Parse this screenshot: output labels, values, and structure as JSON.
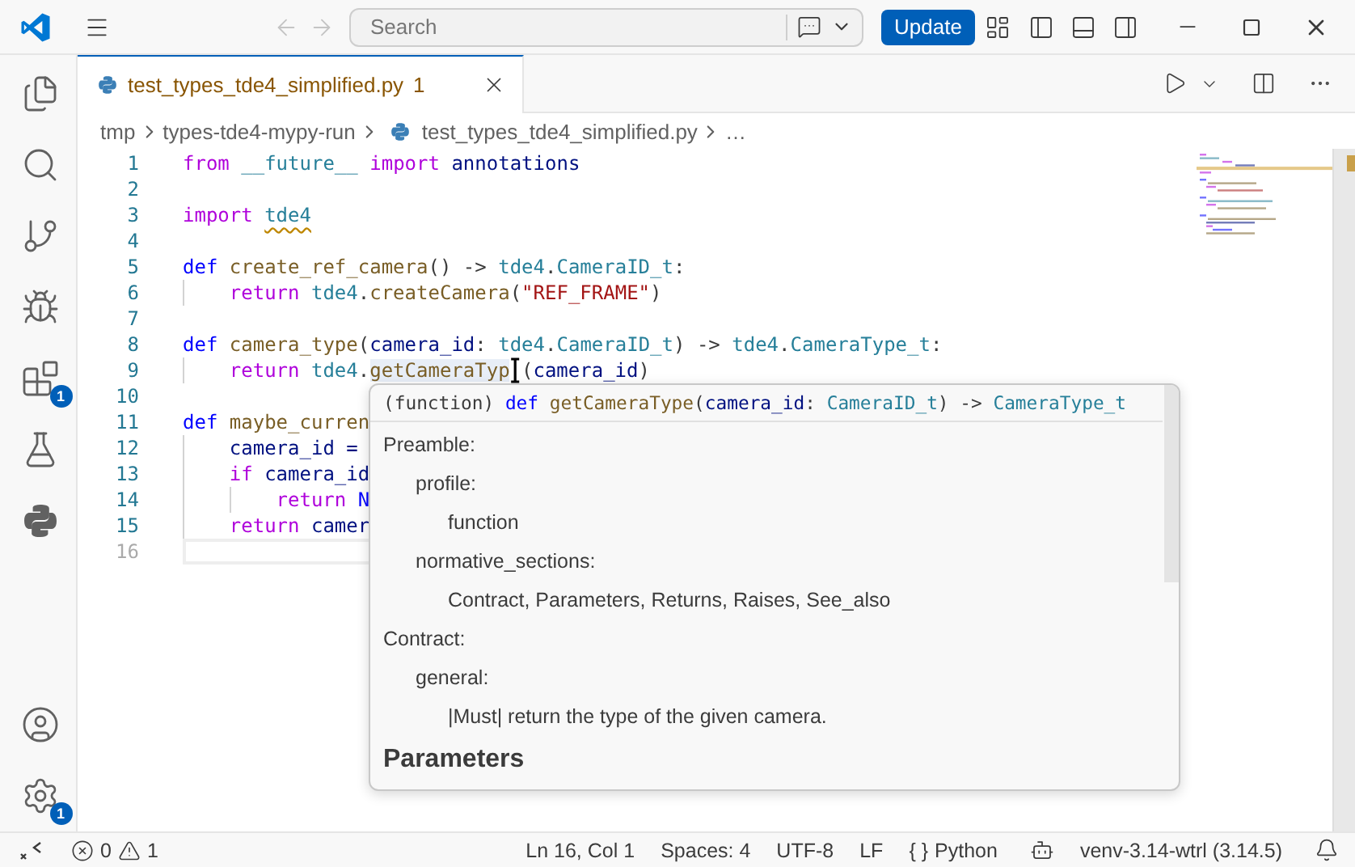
{
  "title_bar": {
    "nav": [
      {
        "kind": "back",
        "disabled": true
      },
      {
        "kind": "forward",
        "disabled": true
      }
    ],
    "search": {
      "placeholder": "Search"
    },
    "update_button": "Update"
  },
  "activity_bar": {
    "items": [
      {
        "kind": "files",
        "selected": false
      },
      {
        "kind": "search",
        "selected": false
      },
      {
        "kind": "source_control",
        "selected": false
      },
      {
        "kind": "debug",
        "selected": false
      },
      {
        "kind": "extensions",
        "selected": false,
        "badge": "1"
      },
      {
        "kind": "testing",
        "selected": false
      },
      {
        "kind": "python",
        "selected": false
      }
    ],
    "bottom": [
      {
        "kind": "account"
      },
      {
        "kind": "settings",
        "badge": "1"
      }
    ]
  },
  "tabs": [
    {
      "label": "test_types_tde4_simplified.py",
      "problems": "1",
      "selected": true
    }
  ],
  "breadcrumbs": [
    {
      "label": "tmp",
      "kind": "folder"
    },
    {
      "label": "types-tde4-mypy-run",
      "kind": "folder"
    },
    {
      "label": "test_types_tde4_simplified.py",
      "kind": "file"
    },
    {
      "label": "…",
      "kind": "more"
    }
  ],
  "editor": {
    "lines": [
      {
        "number": "1",
        "current": false,
        "tokens": [
          {
            "t": "from",
            "kind": "keyword"
          },
          {
            "t": " __future__",
            "kind": "type"
          },
          {
            "t": " import",
            "kind": "keyword"
          },
          {
            "t": " annotations",
            "kind": "param"
          }
        ]
      },
      {
        "number": "2",
        "current": false
      },
      {
        "number": "3",
        "current": false,
        "tokens": [
          {
            "t": "import",
            "kind": "keyword"
          },
          {
            "t": "tde4",
            "kind": "module_warn"
          }
        ]
      },
      {
        "number": "4",
        "current": false
      },
      {
        "number": "5",
        "current": false,
        "tokens": [
          {
            "t": "def",
            "kind": "def"
          },
          {
            "t": " create_ref_camera",
            "kind": "fn"
          },
          {
            "t": "() -> ",
            "kind": "plain"
          },
          {
            "t": "tde4",
            "kind": "type"
          },
          {
            "t": ".",
            "kind": "plain"
          },
          {
            "t": "CameraID_t",
            "kind": "type"
          },
          {
            "t": ":",
            "kind": "plain"
          }
        ]
      },
      {
        "number": "6",
        "current": false,
        "tokens": [
          {
            "kind": "indent"
          },
          {
            "t": "return",
            "kind": "keyword"
          },
          {
            "t": " tde4",
            "kind": "type"
          },
          {
            "t": ".",
            "kind": "plain"
          },
          {
            "t": "createCamera",
            "kind": "fn"
          },
          {
            "t": "(",
            "kind": "plain"
          },
          {
            "t": "\"REF_FRAME\"",
            "kind": "string"
          },
          {
            "t": ")",
            "kind": "plain"
          }
        ]
      },
      {
        "number": "7",
        "current": false
      },
      {
        "number": "8",
        "current": false,
        "tokens": [
          {
            "t": "def",
            "kind": "def"
          },
          {
            "t": " camera_type",
            "kind": "fn"
          },
          {
            "t": "(",
            "kind": "plain"
          },
          {
            "t": "camera_id",
            "kind": "param"
          },
          {
            "t": ": ",
            "kind": "plain"
          },
          {
            "t": "tde4",
            "kind": "type"
          },
          {
            "t": ".",
            "kind": "plain"
          },
          {
            "t": "CameraID_t",
            "kind": "type"
          },
          {
            "t": ") -> ",
            "kind": "plain"
          },
          {
            "t": "tde4",
            "kind": "type"
          },
          {
            "t": ".",
            "kind": "plain"
          },
          {
            "t": "CameraType_t",
            "kind": "type"
          },
          {
            "t": ":",
            "kind": "plain"
          }
        ]
      },
      {
        "number": "9",
        "current": false,
        "tokens": [
          {
            "kind": "indent"
          },
          {
            "t": "return",
            "kind": "keyword"
          },
          {
            "t": " tde4",
            "kind": "type"
          },
          {
            "t": ".",
            "kind": "plain"
          },
          {
            "t": "getCameraTyp",
            "kind": "fn_hover"
          },
          {
            "kind": "ibeam"
          },
          {
            "t": "(",
            "kind": "plain"
          },
          {
            "t": "camera_id",
            "kind": "param"
          },
          {
            "t": ")",
            "kind": "plain"
          }
        ]
      },
      {
        "number": "10",
        "current": false
      },
      {
        "number": "11",
        "current": false,
        "tokens": [
          {
            "t": "def",
            "kind": "def"
          },
          {
            "t": " maybe_curren",
            "kind": "fn"
          }
        ]
      },
      {
        "number": "12",
        "current": false,
        "tokens": [
          {
            "kind": "indent"
          },
          {
            "t": "camera_id =",
            "kind": "param"
          }
        ]
      },
      {
        "number": "13",
        "current": false,
        "tokens": [
          {
            "kind": "indent"
          },
          {
            "t": "if",
            "kind": "keyword"
          },
          {
            "t": " camera_id",
            "kind": "param"
          }
        ]
      },
      {
        "number": "14",
        "current": false,
        "tokens": [
          {
            "kind": "indent"
          },
          {
            "kind": "indent"
          },
          {
            "t": "return",
            "kind": "keyword"
          },
          {
            "t": " N",
            "kind": "const"
          }
        ]
      },
      {
        "number": "15",
        "current": false,
        "tokens": [
          {
            "kind": "indent"
          },
          {
            "t": "return",
            "kind": "keyword"
          },
          {
            "t": " camer",
            "kind": "param"
          }
        ]
      },
      {
        "number": "16",
        "current": true
      }
    ]
  },
  "hover": {
    "signature": [
      {
        "t": "(function) ",
        "kind": "plain"
      },
      {
        "t": "def",
        "kind": "def"
      },
      {
        "t": " getCameraType",
        "kind": "fn"
      },
      {
        "t": "(",
        "kind": "plain"
      },
      {
        "t": "camera_id",
        "kind": "param"
      },
      {
        "t": ": ",
        "kind": "plain"
      },
      {
        "t": "CameraID_t",
        "kind": "type"
      },
      {
        "t": ") -> ",
        "kind": "plain"
      },
      {
        "t": "CameraType_t",
        "kind": "type"
      }
    ],
    "sections": [
      {
        "text": "Preamble:",
        "children": [
          {
            "text": "profile:",
            "children": [
              {
                "text": "function"
              }
            ]
          },
          {
            "text": "normative_sections:",
            "children": [
              {
                "text": "Contract, Parameters, Returns, Raises, See_also"
              }
            ]
          }
        ]
      },
      {
        "text": "Contract:",
        "children": [
          {
            "text": "general:",
            "children": [
              {
                "text": "|Must| return the type of the given camera."
              }
            ]
          }
        ]
      }
    ],
    "heading": "Parameters"
  },
  "status_bar": {
    "errors": "0",
    "warnings": "1",
    "items": [
      {
        "kind": "text",
        "text": "Ln 16, Col 1"
      },
      {
        "kind": "text",
        "text": "Spaces: 4"
      },
      {
        "kind": "text",
        "text": "UTF-8"
      },
      {
        "kind": "text",
        "text": "LF"
      },
      {
        "kind": "language",
        "icon": "{ }",
        "text": "Python"
      },
      {
        "kind": "copilot"
      },
      {
        "kind": "text",
        "text": "venv-3.14-wtrl (3.14.5)"
      },
      {
        "kind": "bell"
      }
    ]
  }
}
